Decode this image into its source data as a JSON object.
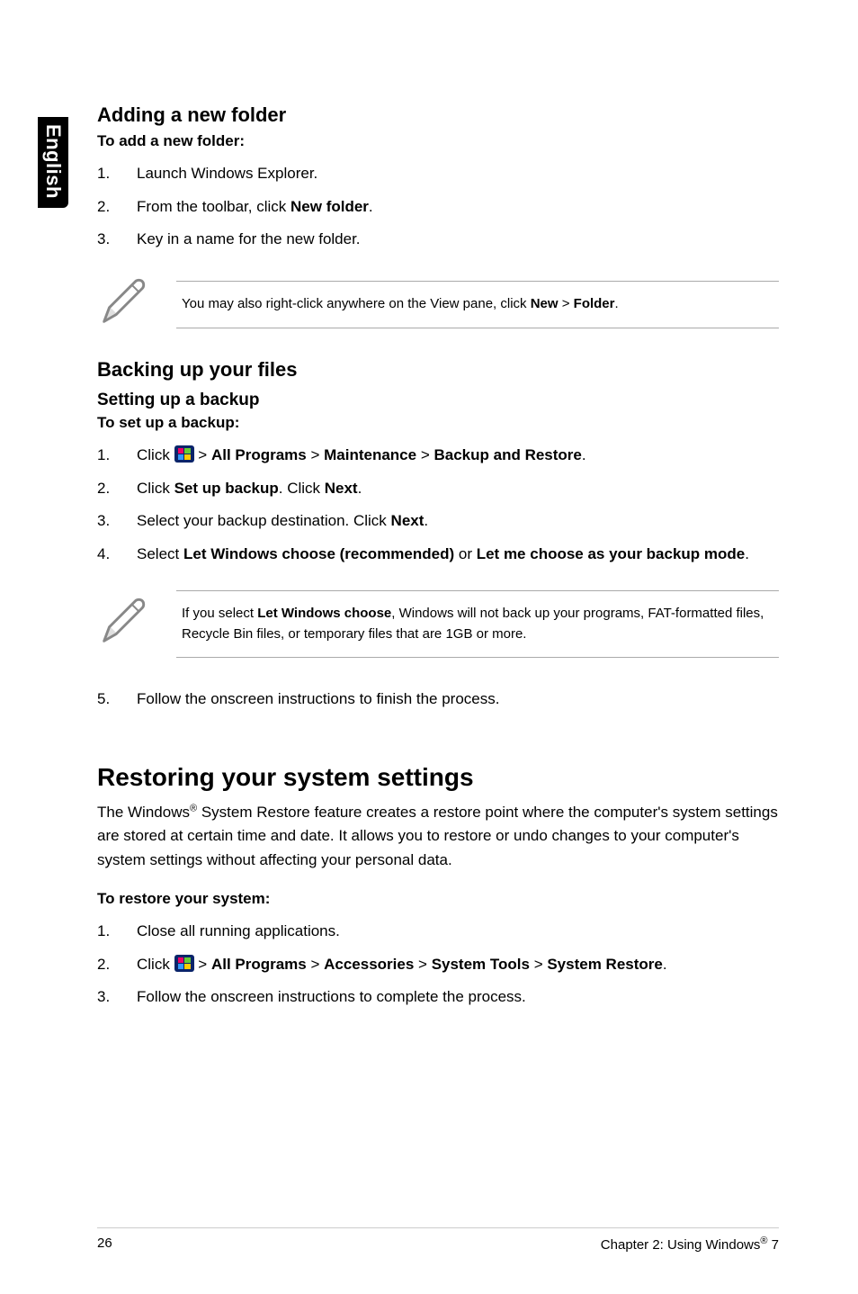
{
  "side_tab": "English",
  "adding_folder": {
    "heading": "Adding a new folder",
    "sub": "To add a new folder:",
    "steps": [
      "Launch Windows Explorer.",
      {
        "pre": "From the toolbar, click ",
        "bold": "New folder",
        "post": "."
      },
      "Key in a name for the new folder."
    ],
    "note": {
      "text": "You may also right-click anywhere on the View pane, click ",
      "b1": "New",
      "mid": " > ",
      "b2": "Folder",
      "end": "."
    }
  },
  "backup": {
    "heading": "Backing up your files",
    "sub1": "Setting up a backup",
    "sub2": "To set up a backup:",
    "step1": {
      "pre": "Click ",
      "path_parts": [
        " > ",
        "All Programs",
        " > ",
        "Maintenance",
        " > ",
        "Backup and Restore"
      ],
      "post": "."
    },
    "step2": {
      "t1": "Click ",
      "b1": "Set up backup",
      "t2": ". Click ",
      "b2": "Next",
      "t3": "."
    },
    "step3": {
      "t1": "Select your backup destination. Click ",
      "b1": "Next",
      "t2": "."
    },
    "step4": {
      "t1": "Select ",
      "b1": "Let Windows choose (recommended)",
      "t2": " or ",
      "b2": "Let me choose as your backup mode",
      "t3": "."
    },
    "note2": {
      "t1": "If you select ",
      "b1": "Let Windows choose",
      "t2": ", Windows will not back up your programs, FAT-formatted files, Recycle Bin files, or temporary files that are 1GB or more."
    },
    "step5": "Follow the onscreen instructions to finish the process."
  },
  "restore": {
    "heading": "Restoring your system settings",
    "body": {
      "t1": "The Windows",
      "sup": "®",
      "t2": " System Restore feature creates a restore point where the computer's system settings are stored at certain time and date. It allows you to restore or undo changes to your computer's system settings without affecting your personal data."
    },
    "sub": "To restore your system:",
    "step1": "Close all running applications.",
    "step2": {
      "pre": "Click ",
      "path_parts": [
        " > ",
        "All Programs",
        " > ",
        "Accessories",
        " > ",
        "System Tools",
        " > ",
        "System Restore"
      ],
      "post": "."
    },
    "step3": "Follow the onscreen instructions to complete the process."
  },
  "footer": {
    "page_num": "26",
    "chapter_pre": "Chapter 2: Using Windows",
    "chapter_sup": "®",
    "chapter_post": " 7"
  }
}
